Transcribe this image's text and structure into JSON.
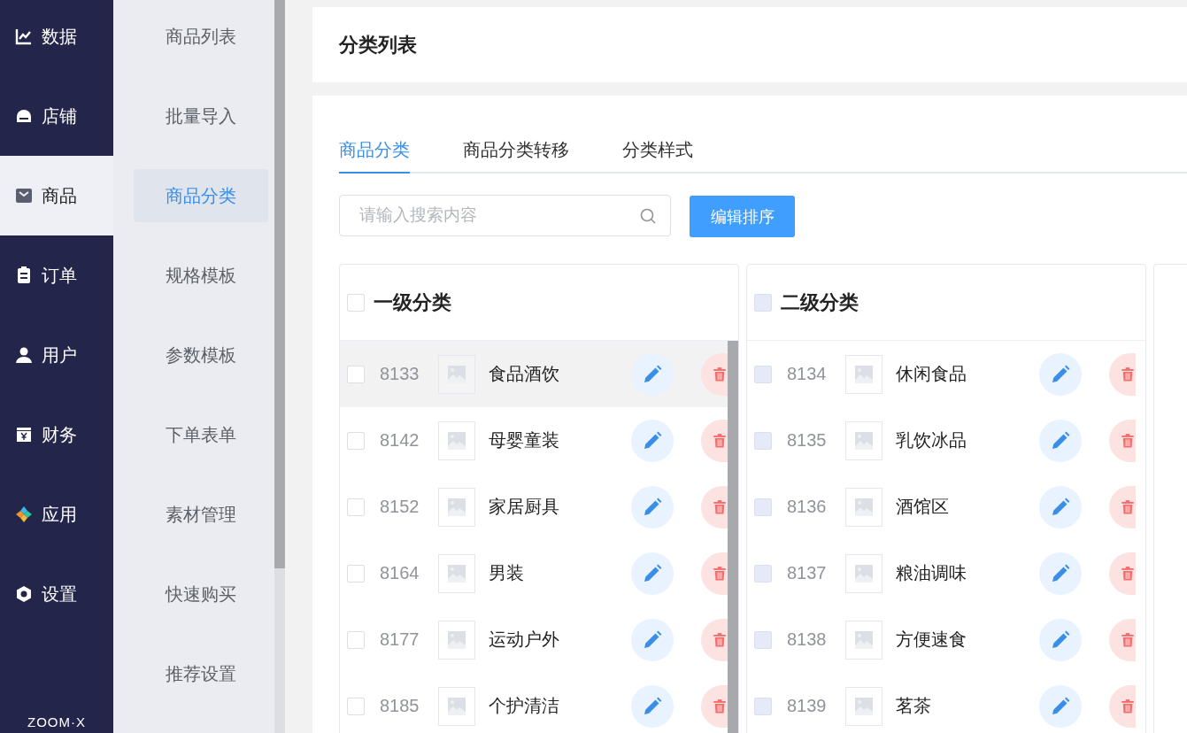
{
  "nav": {
    "items": [
      {
        "label": "数据",
        "selected": false
      },
      {
        "label": "店铺",
        "selected": false
      },
      {
        "label": "商品",
        "selected": true
      },
      {
        "label": "订单",
        "selected": false
      },
      {
        "label": "用户",
        "selected": false
      },
      {
        "label": "财务",
        "selected": false
      },
      {
        "label": "应用",
        "selected": false
      },
      {
        "label": "设置",
        "selected": false
      }
    ],
    "logo": "ZOOM·X"
  },
  "submenu": {
    "items": [
      {
        "label": "商品列表",
        "selected": false
      },
      {
        "label": "批量导入",
        "selected": false
      },
      {
        "label": "商品分类",
        "selected": true
      },
      {
        "label": "规格模板",
        "selected": false
      },
      {
        "label": "参数模板",
        "selected": false
      },
      {
        "label": "下单表单",
        "selected": false
      },
      {
        "label": "素材管理",
        "selected": false
      },
      {
        "label": "快速购买",
        "selected": false
      },
      {
        "label": "推荐设置",
        "selected": false
      }
    ]
  },
  "page_title": "分类列表",
  "tabs": [
    {
      "label": "商品分类",
      "selected": true
    },
    {
      "label": "商品分类转移",
      "selected": false
    },
    {
      "label": "分类样式",
      "selected": false
    }
  ],
  "search": {
    "placeholder": "请输入搜索内容"
  },
  "sort_button": "编辑排序",
  "panels": [
    {
      "title": "一级分类",
      "disabled": false,
      "checked": false,
      "rows": [
        {
          "id": "8133",
          "name": "食品酒饮",
          "checked": false,
          "hovered": true
        },
        {
          "id": "8142",
          "name": "母婴童装",
          "checked": false,
          "hovered": false
        },
        {
          "id": "8152",
          "name": "家居厨具",
          "checked": false,
          "hovered": false
        },
        {
          "id": "8164",
          "name": "男装",
          "checked": false,
          "hovered": false
        },
        {
          "id": "8177",
          "name": "运动户外",
          "checked": false,
          "hovered": false
        },
        {
          "id": "8185",
          "name": "个护清洁",
          "checked": false,
          "hovered": false
        }
      ]
    },
    {
      "title": "二级分类",
      "disabled": true,
      "checked": false,
      "rows": [
        {
          "id": "8134",
          "name": "休闲食品",
          "checked": false,
          "hovered": false
        },
        {
          "id": "8135",
          "name": "乳饮冰品",
          "checked": false,
          "hovered": false
        },
        {
          "id": "8136",
          "name": "酒馆区",
          "checked": false,
          "hovered": false
        },
        {
          "id": "8137",
          "name": "粮油调味",
          "checked": false,
          "hovered": false
        },
        {
          "id": "8138",
          "name": "方便速食",
          "checked": false,
          "hovered": false
        },
        {
          "id": "8139",
          "name": "茗茶",
          "checked": false,
          "hovered": false
        }
      ]
    }
  ]
}
